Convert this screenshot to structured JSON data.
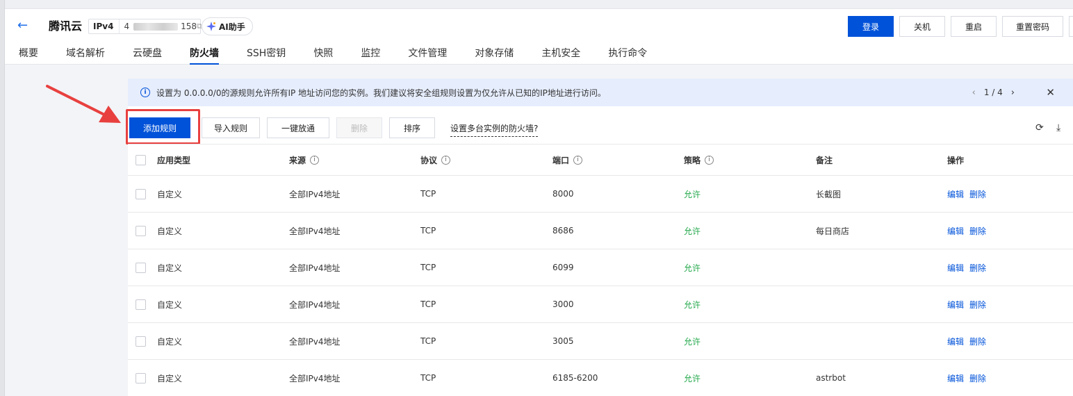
{
  "header": {
    "title": "腾讯云",
    "ip_label": "IPv4",
    "ip_value_prefix": "4",
    "ip_value_suffix": "158",
    "ai_label": "AI助手",
    "buttons": {
      "login": "登录",
      "shutdown": "关机",
      "restart": "重启",
      "reset_password": "重置密码"
    }
  },
  "tabs": [
    "概要",
    "域名解析",
    "云硬盘",
    "防火墙",
    "SSH密钥",
    "快照",
    "监控",
    "文件管理",
    "对象存储",
    "主机安全",
    "执行命令"
  ],
  "active_tab": "防火墙",
  "notice": {
    "text": "设置为 0.0.0.0/0的源规则允许所有IP 地址访问您的实例。我们建议将安全组规则设置为仅允许从已知的IP地址进行访问。",
    "page": "1 / 4"
  },
  "toolbar": {
    "add_rule": "添加规则",
    "import_rule": "导入规则",
    "allow_all": "一键放通",
    "delete": "删除",
    "sort": "排序",
    "multi_instance": "设置多台实例的防火墙?"
  },
  "table": {
    "columns": [
      "应用类型",
      "来源",
      "协议",
      "端口",
      "策略",
      "备注",
      "操作"
    ],
    "rows": [
      {
        "type": "自定义",
        "source": "全部IPv4地址",
        "protocol": "TCP",
        "port": "8000",
        "policy": "允许",
        "note": "长截图",
        "edit": "编辑",
        "delete": "删除"
      },
      {
        "type": "自定义",
        "source": "全部IPv4地址",
        "protocol": "TCP",
        "port": "8686",
        "policy": "允许",
        "note": "每日商店",
        "edit": "编辑",
        "delete": "删除"
      },
      {
        "type": "自定义",
        "source": "全部IPv4地址",
        "protocol": "TCP",
        "port": "6099",
        "policy": "允许",
        "note": "",
        "edit": "编辑",
        "delete": "删除"
      },
      {
        "type": "自定义",
        "source": "全部IPv4地址",
        "protocol": "TCP",
        "port": "3000",
        "policy": "允许",
        "note": "",
        "edit": "编辑",
        "delete": "删除"
      },
      {
        "type": "自定义",
        "source": "全部IPv4地址",
        "protocol": "TCP",
        "port": "3005",
        "policy": "允许",
        "note": "",
        "edit": "编辑",
        "delete": "删除"
      },
      {
        "type": "自定义",
        "source": "全部IPv4地址",
        "protocol": "TCP",
        "port": "6185-6200",
        "policy": "允许",
        "note": "astrbot",
        "edit": "编辑",
        "delete": "删除"
      }
    ]
  },
  "colors": {
    "primary": "#0052d9",
    "allow": "#22a84a",
    "annotation": "#e8403f",
    "notice_bg": "#e6edfd"
  }
}
